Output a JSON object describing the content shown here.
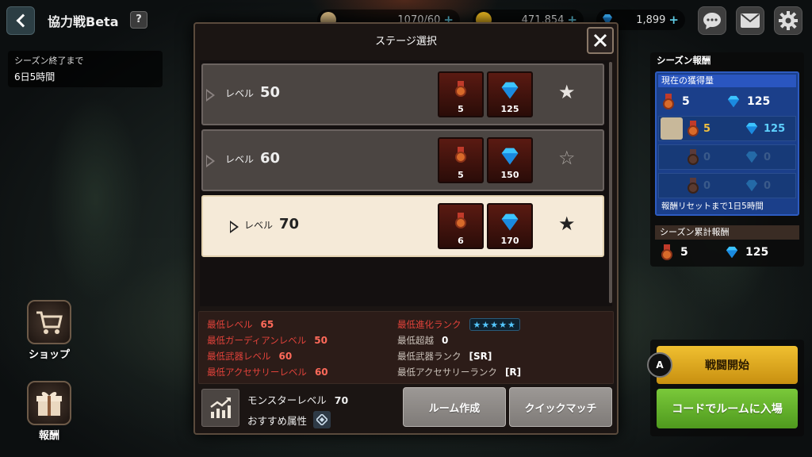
{
  "header": {
    "title": "協力戦Beta",
    "help_label": "?",
    "currencies": [
      {
        "name": "stamina",
        "value": "1070/60",
        "color": "#d6b880"
      },
      {
        "name": "gold",
        "value": "471,854",
        "color": "#e6b420"
      },
      {
        "name": "gem",
        "value": "1,899",
        "color": "#3cb4ff"
      }
    ],
    "plus": "+"
  },
  "season": {
    "label": "シーズン終了まで",
    "time": "6日5時間"
  },
  "side_buttons": {
    "shop": "ショップ",
    "reward": "報酬"
  },
  "modal": {
    "title": "ステージ選択",
    "close": "✕",
    "level_label": "レベル",
    "stages": [
      {
        "level": "50",
        "medal": "5",
        "gem": "125",
        "star": "★",
        "star_color": "#e8e4e0",
        "selected": false
      },
      {
        "level": "60",
        "medal": "5",
        "gem": "150",
        "star": "☆",
        "star_color": "#aaa5a0",
        "selected": false
      },
      {
        "level": "70",
        "medal": "6",
        "gem": "170",
        "star": "★",
        "star_color": "#222222",
        "selected": true
      }
    ],
    "requirements_left": [
      {
        "label": "最低レベル",
        "value": "65"
      },
      {
        "label": "最低ガーディアンレベル",
        "value": "50"
      },
      {
        "label": "最低武器レベル",
        "value": "60"
      },
      {
        "label": "最低アクセサリーレベル",
        "value": "60"
      }
    ],
    "requirements_right": [
      {
        "label": "最低進化ランク",
        "value": "★★★★★"
      },
      {
        "label": "最低超越",
        "value": "0"
      },
      {
        "label": "最低武器ランク",
        "value": "[SR]"
      },
      {
        "label": "最低アクセサリーランク",
        "value": "[R]"
      }
    ],
    "monster_level_label": "モンスターレベル",
    "monster_level": "70",
    "attribute_label": "おすすめ属性",
    "create_room": "ルーム作成",
    "quick_match": "クイックマッチ"
  },
  "reward_panel": {
    "title": "シーズン報酬",
    "current_label": "現在の獲得量",
    "current": {
      "medal": "5",
      "gem": "125"
    },
    "player": {
      "medal": "5",
      "gem": "125"
    },
    "empty_slots": [
      {
        "medal": "0",
        "gem": "0"
      },
      {
        "medal": "0",
        "gem": "0"
      }
    ],
    "reset_text": "報酬リセットまで1日5時間",
    "cumulative_label": "シーズン累計報酬",
    "cumulative": {
      "medal": "5",
      "gem": "125"
    }
  },
  "actions": {
    "a_key": "A",
    "start_battle": "戦闘開始",
    "join_by_code": "コードでルームに入場"
  }
}
